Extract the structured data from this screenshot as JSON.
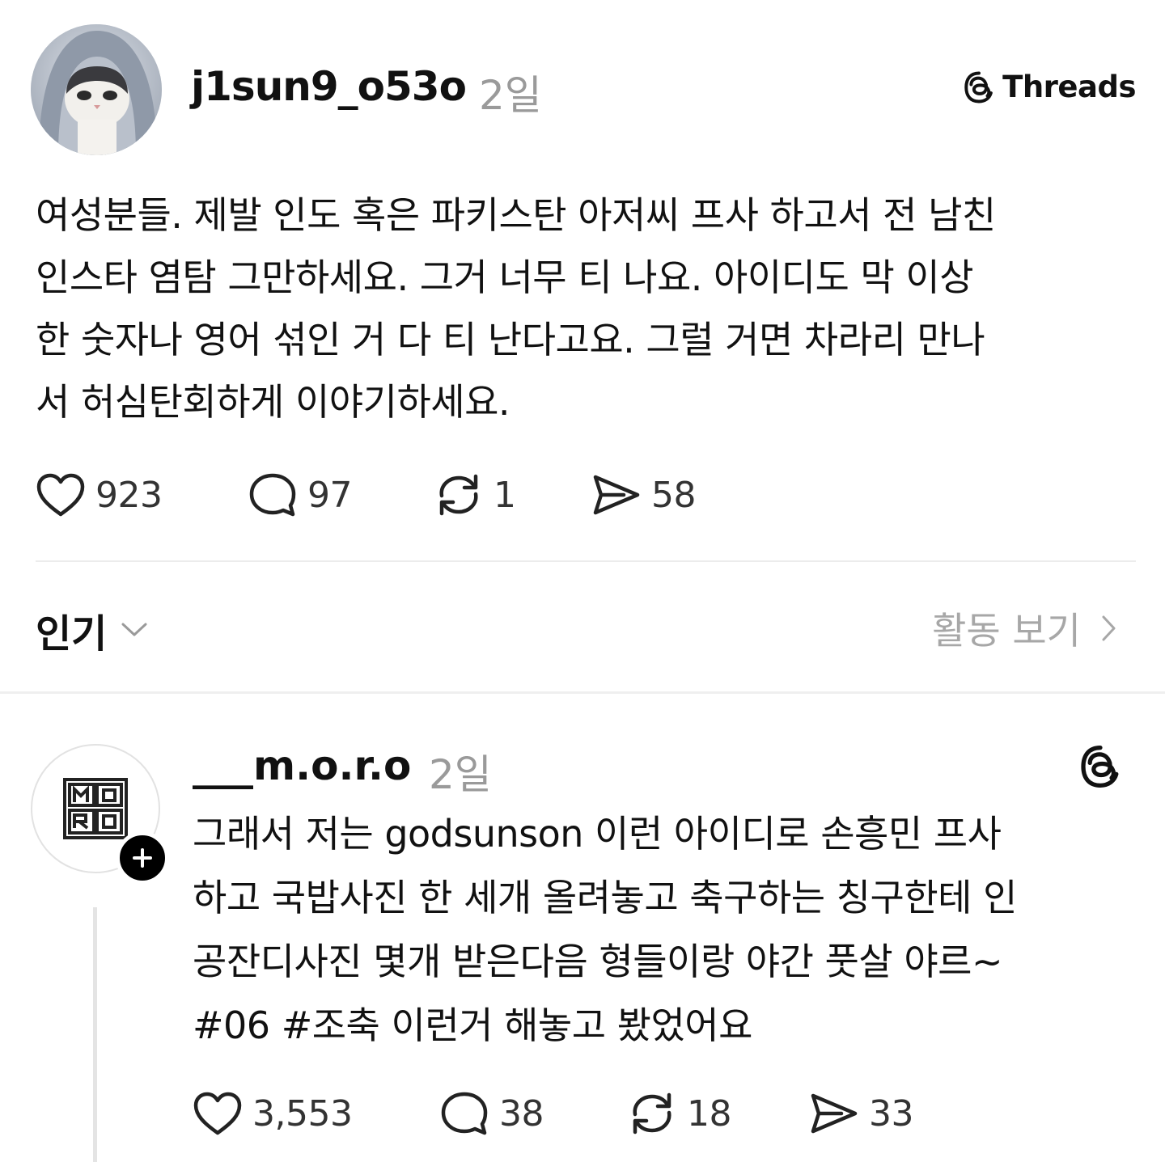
{
  "post": {
    "username": "j1sun9_o53o",
    "time": "2일",
    "brand": "Threads",
    "lines": [
      "여성분들. 제발 인도 혹은 파키스탄 아저씨 프사 하고서 전 남친",
      "인스타 염탐 그만하세요. 그거 너무 티 나요. 아이디도 막 이상",
      "한 숫자나 영어 섞인 거 다 티 난다고요. 그럴 거면 차라리 만나",
      "서 허심탄회하게 이야기하세요."
    ],
    "likes": "923",
    "replies": "97",
    "reposts": "1",
    "shares": "58"
  },
  "sort": {
    "label": "인기",
    "view_activity": "활동 보기"
  },
  "reply": {
    "username": "___m.o.r.o",
    "time": "2일",
    "lines": [
      "그래서 저는 godsunson 이런 아이디로 손흥민 프사",
      "하고 국밥사진 한 세개 올려놓고 축구하는 칭구한테 인",
      "공잔디사진 몇개 받은다음 형들이랑 야간 풋살 야르~",
      "#06 #조축  이런거 해놓고 봤었어요"
    ],
    "likes": "3,553",
    "replies": "38",
    "reposts": "18",
    "shares": "33"
  },
  "icons": {
    "like": "heart-icon",
    "reply": "speech-bubble-icon",
    "repost": "repost-icon",
    "share": "send-icon",
    "brand": "threads-logo-icon",
    "sort": "chevron-down-icon",
    "activity": "chevron-right-icon",
    "follow": "plus-icon"
  },
  "colors": {
    "text": "#111111",
    "muted": "#9a9a9a",
    "divider": "#ececec",
    "badge": "#000000"
  }
}
